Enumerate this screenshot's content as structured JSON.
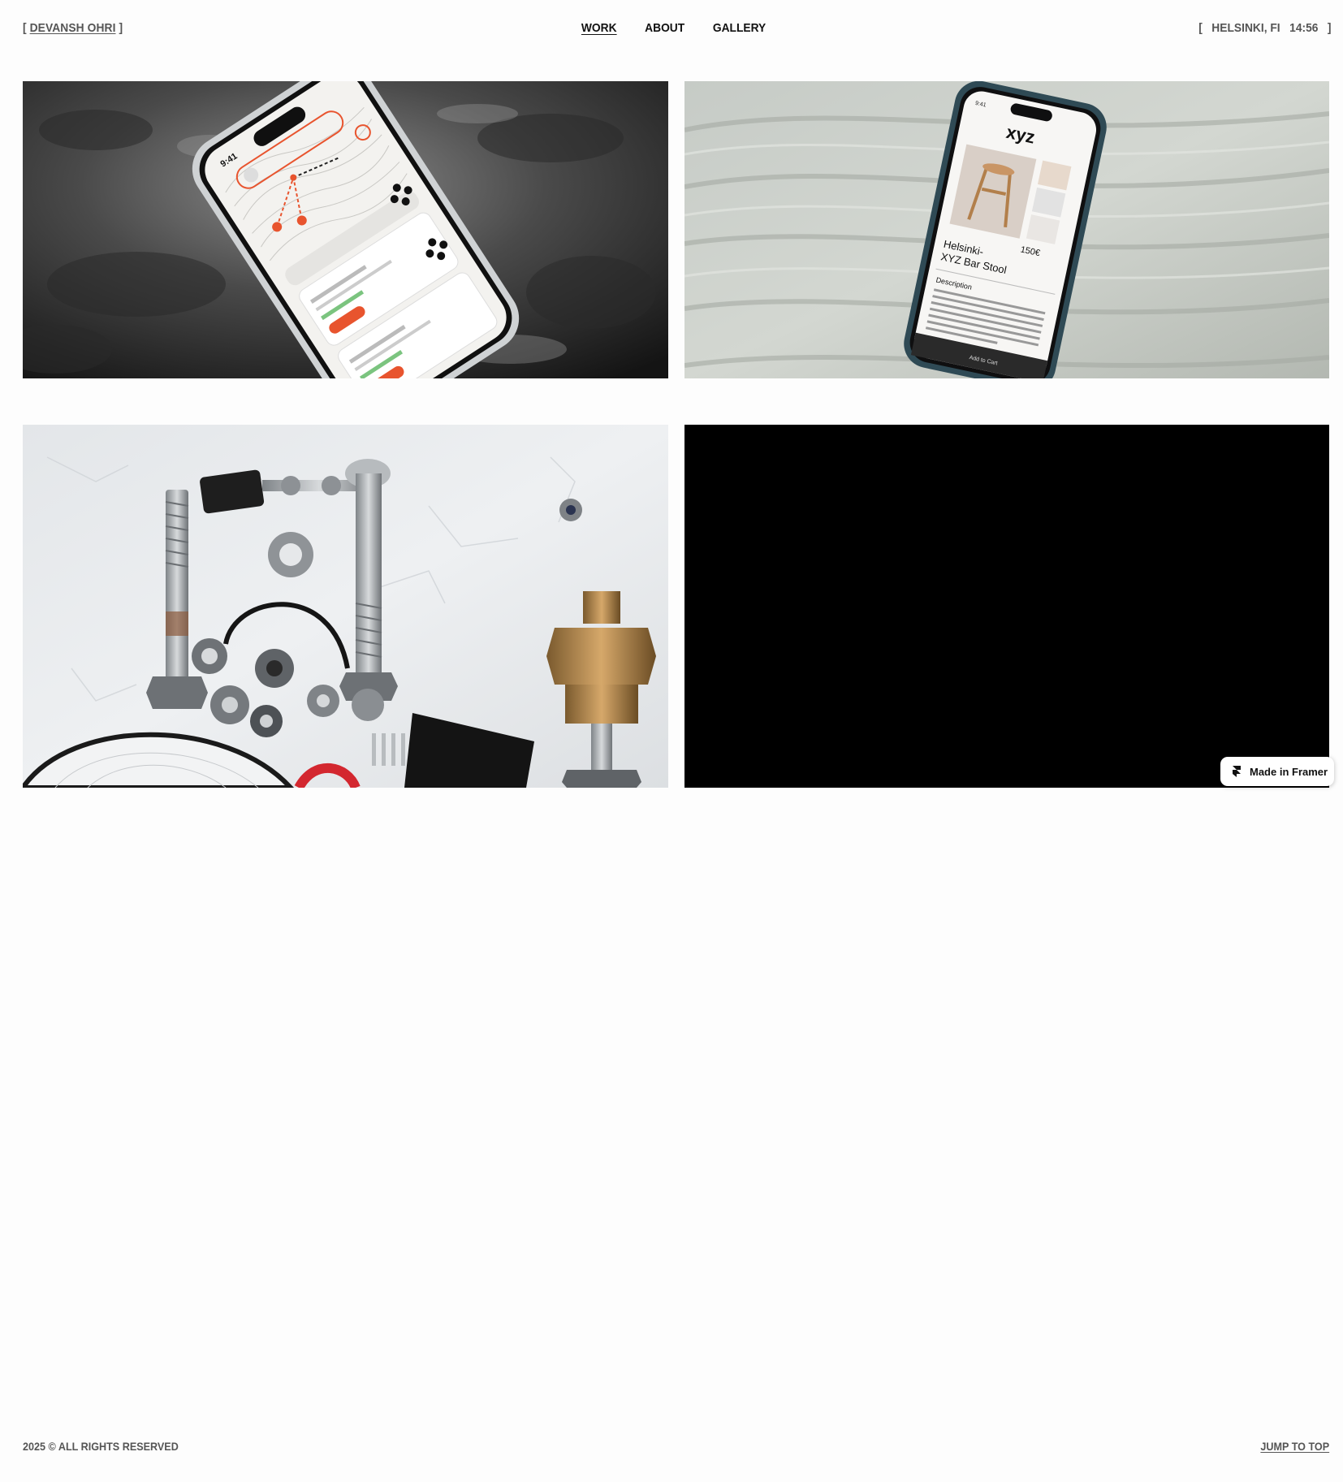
{
  "header": {
    "brand_open": "[ ",
    "brand_name": "DEVANSH OHRI",
    "brand_close": " ]",
    "nav": [
      {
        "label": "WORK",
        "active": true
      },
      {
        "label": "ABOUT",
        "active": false
      },
      {
        "label": "GALLERY",
        "active": false
      }
    ],
    "location": "[   HELSINKI, FI   14:56   ]"
  },
  "projects": [
    {
      "image": "phone-map-app-on-rock",
      "phone_time": "9:41"
    },
    {
      "image": "phone-shop-app-on-fabric",
      "phone_time": "9:41",
      "shop_logo": "xyz",
      "price": "150€",
      "product_title_1": "Helsinki-",
      "product_title_2": "XYZ Bar Stool",
      "description_heading": "Description",
      "cart_label": "Add to Cart"
    },
    {
      "image": "hardware-parts-flatlay"
    },
    {
      "image": "black-video-frame"
    }
  ],
  "framer_badge": {
    "label": "Made in Framer",
    "icon": "framer-icon"
  },
  "footer": {
    "copyright": "2025 © ALL RIGHTS RESERVED",
    "jump_label": "JUMP TO TOP"
  },
  "colors": {
    "accent": "#e8542e",
    "text_muted": "#555555",
    "text_dark": "#111111",
    "background": "#fdfdfd"
  }
}
